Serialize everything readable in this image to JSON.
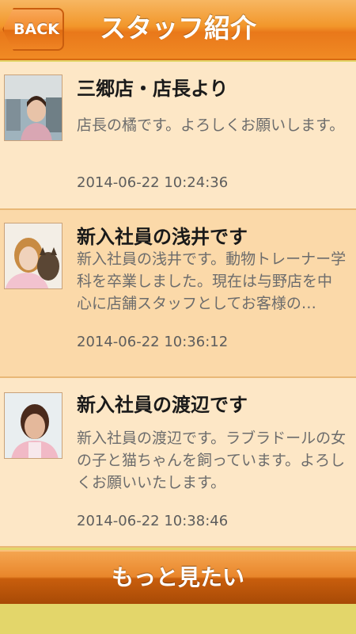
{
  "header": {
    "back_label": "BACK",
    "title": "スタッフ紹介"
  },
  "items": [
    {
      "title": "三郷店・店長より",
      "body": "店長の橘です。よろしくお願いします。",
      "date": "2014-06-22 10:24:36"
    },
    {
      "title": "新入社員の浅井です",
      "body": "新入社員の浅井です。動物トレーナー学科を卒業しました。現在は与野店を中心に店舗スタッフとしてお客様の…",
      "date": "2014-06-22 10:36:12"
    },
    {
      "title": "新入社員の渡辺です",
      "body": "新入社員の渡辺です。ラブラドールの女の子と猫ちゃんを飼っています。よろしくお願いいたします。",
      "date": "2014-06-22 10:38:46"
    }
  ],
  "more_label": "もっと見たい",
  "colors": {
    "header_orange": "#f2962a",
    "item_odd_bg": "#fde7c6",
    "item_even_bg": "#fbd9a9",
    "footer_bg": "#e3d66a"
  }
}
